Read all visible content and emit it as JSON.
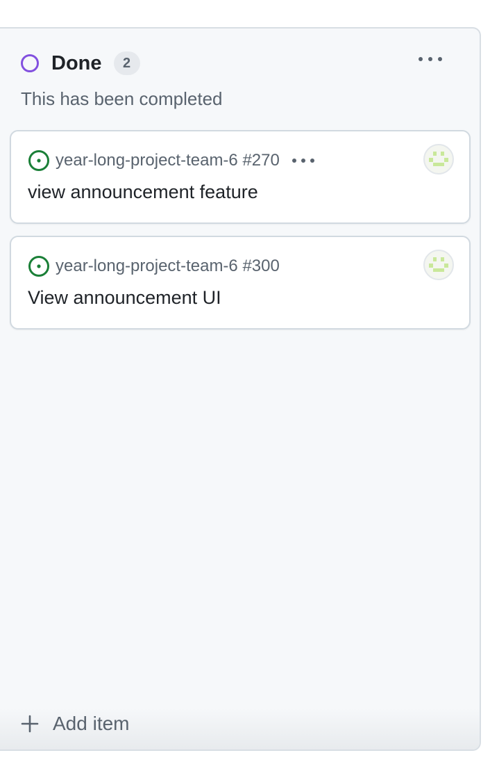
{
  "column": {
    "title": "Done",
    "count": "2",
    "description": "This has been completed",
    "status_color": "#8250df",
    "menu_icon": "kebab-horizontal-icon"
  },
  "cards": [
    {
      "repo_ref": "year-long-project-team-6 #270",
      "title": "view announcement feature",
      "status_icon": "issue-open-icon",
      "has_menu": true
    },
    {
      "repo_ref": "year-long-project-team-6 #300",
      "title": "View announcement UI",
      "status_icon": "issue-open-icon",
      "has_menu": false
    }
  ],
  "add_item": {
    "label": "Add item",
    "icon": "plus-icon"
  },
  "colors": {
    "issue_open": "#1a7f37",
    "avatar_pattern": "#c9e89a",
    "muted_text": "#59636e"
  }
}
